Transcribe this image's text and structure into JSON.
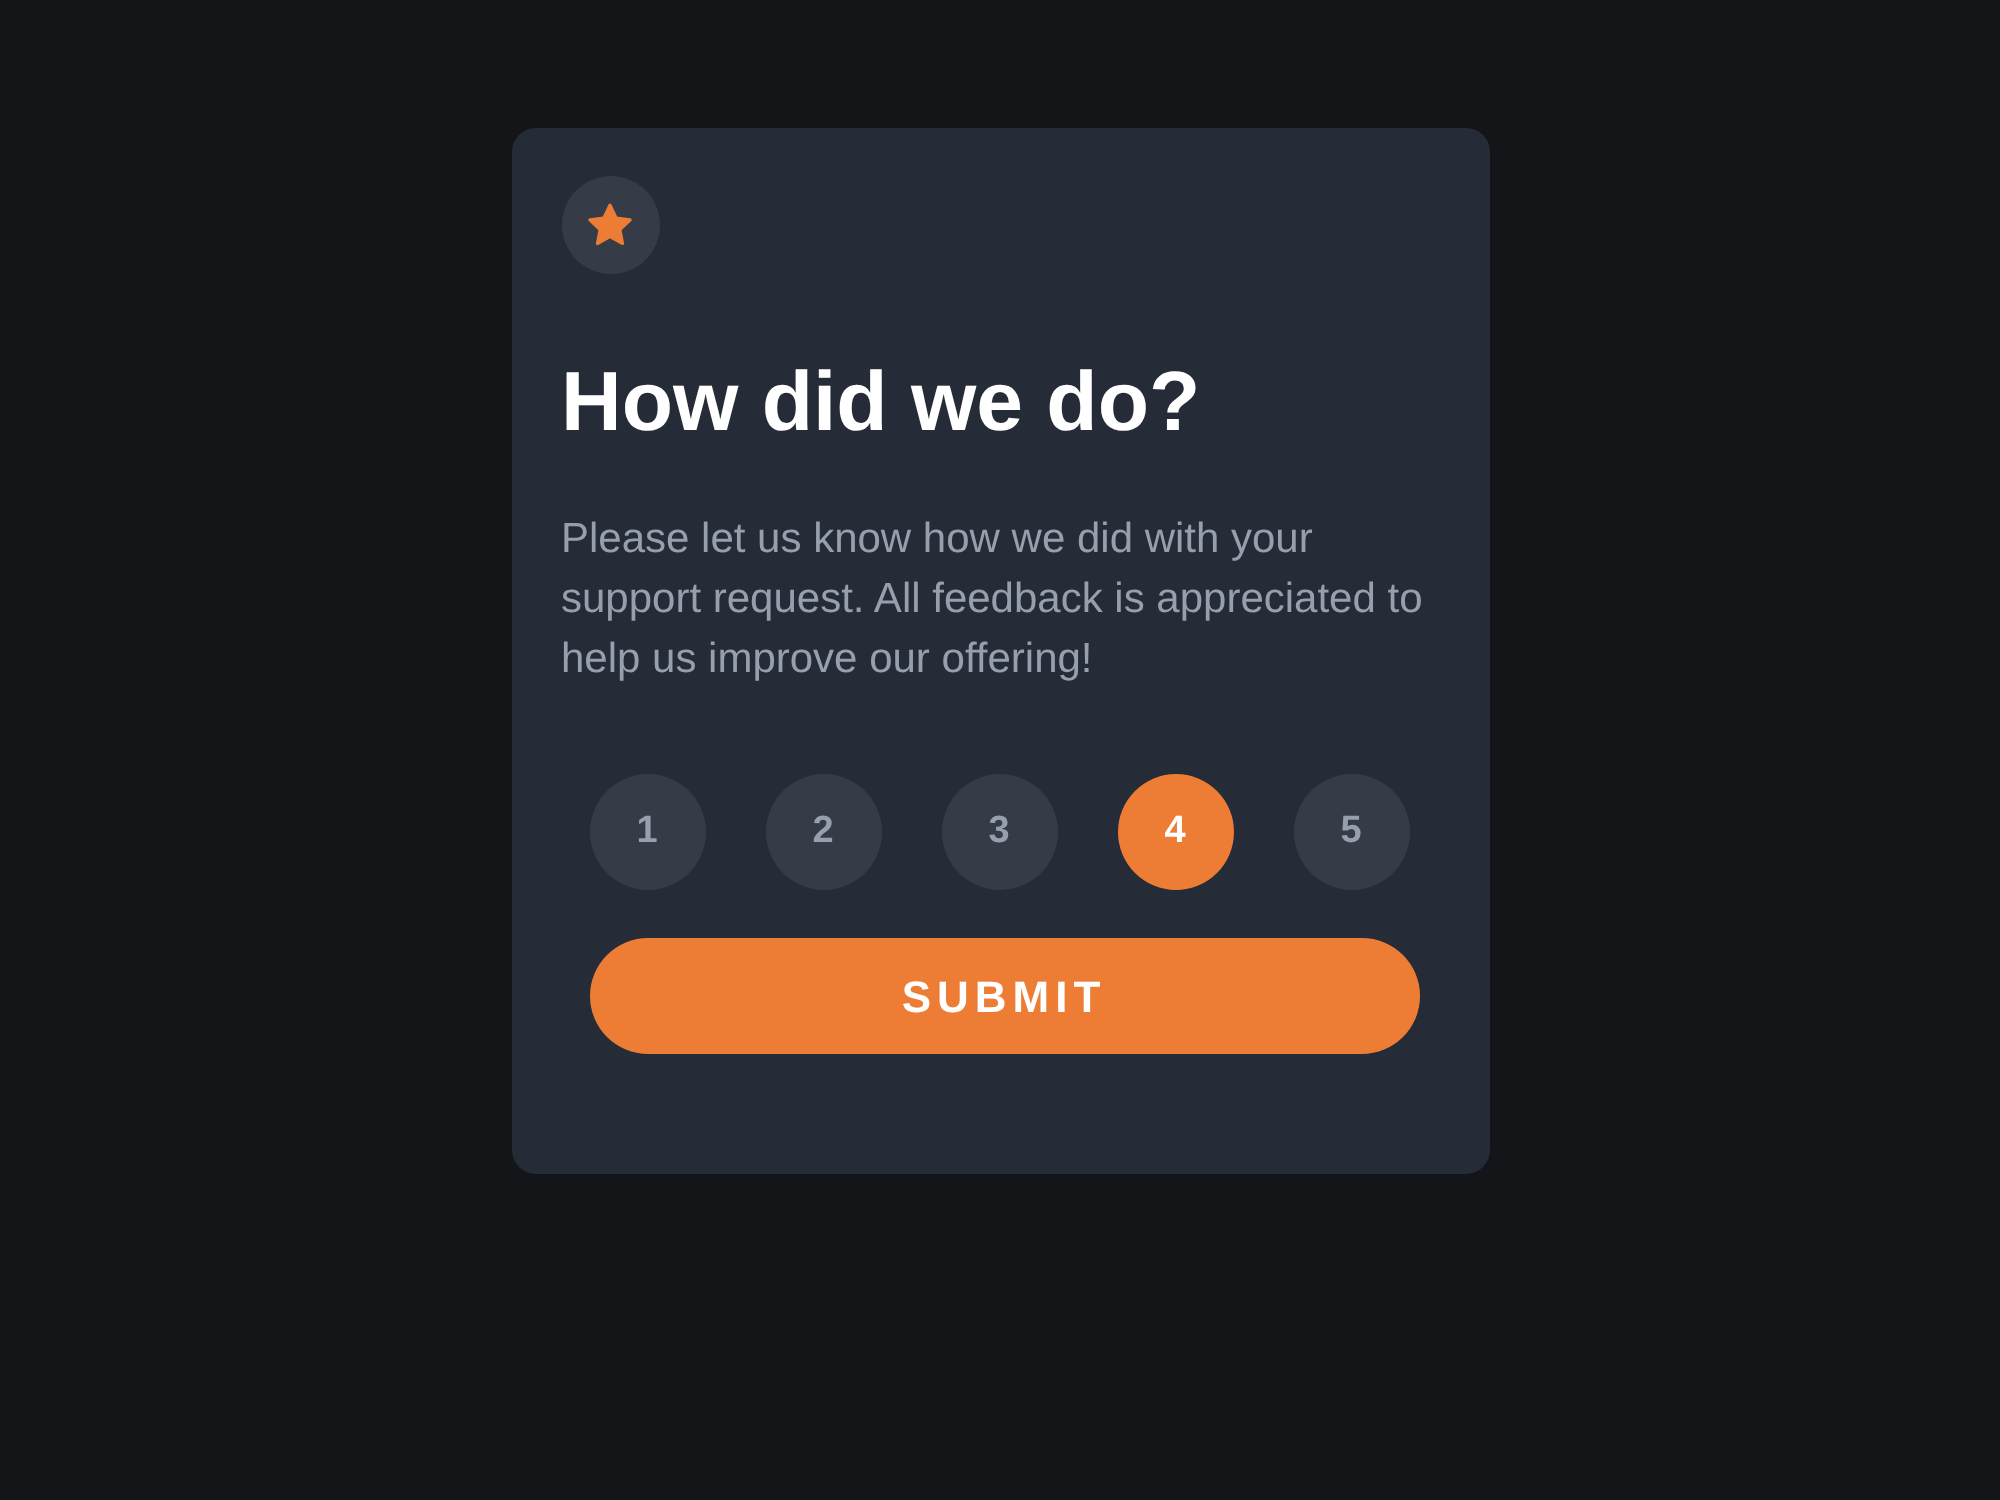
{
  "card": {
    "title": "How did we do?",
    "description": "Please let us know how we did with your support request. All feedback is appreciated to help us improve our offering!",
    "ratings": [
      {
        "label": "1",
        "selected": false
      },
      {
        "label": "2",
        "selected": false
      },
      {
        "label": "3",
        "selected": false
      },
      {
        "label": "4",
        "selected": true
      },
      {
        "label": "5",
        "selected": false
      }
    ],
    "submit": "SUBMIT"
  }
}
